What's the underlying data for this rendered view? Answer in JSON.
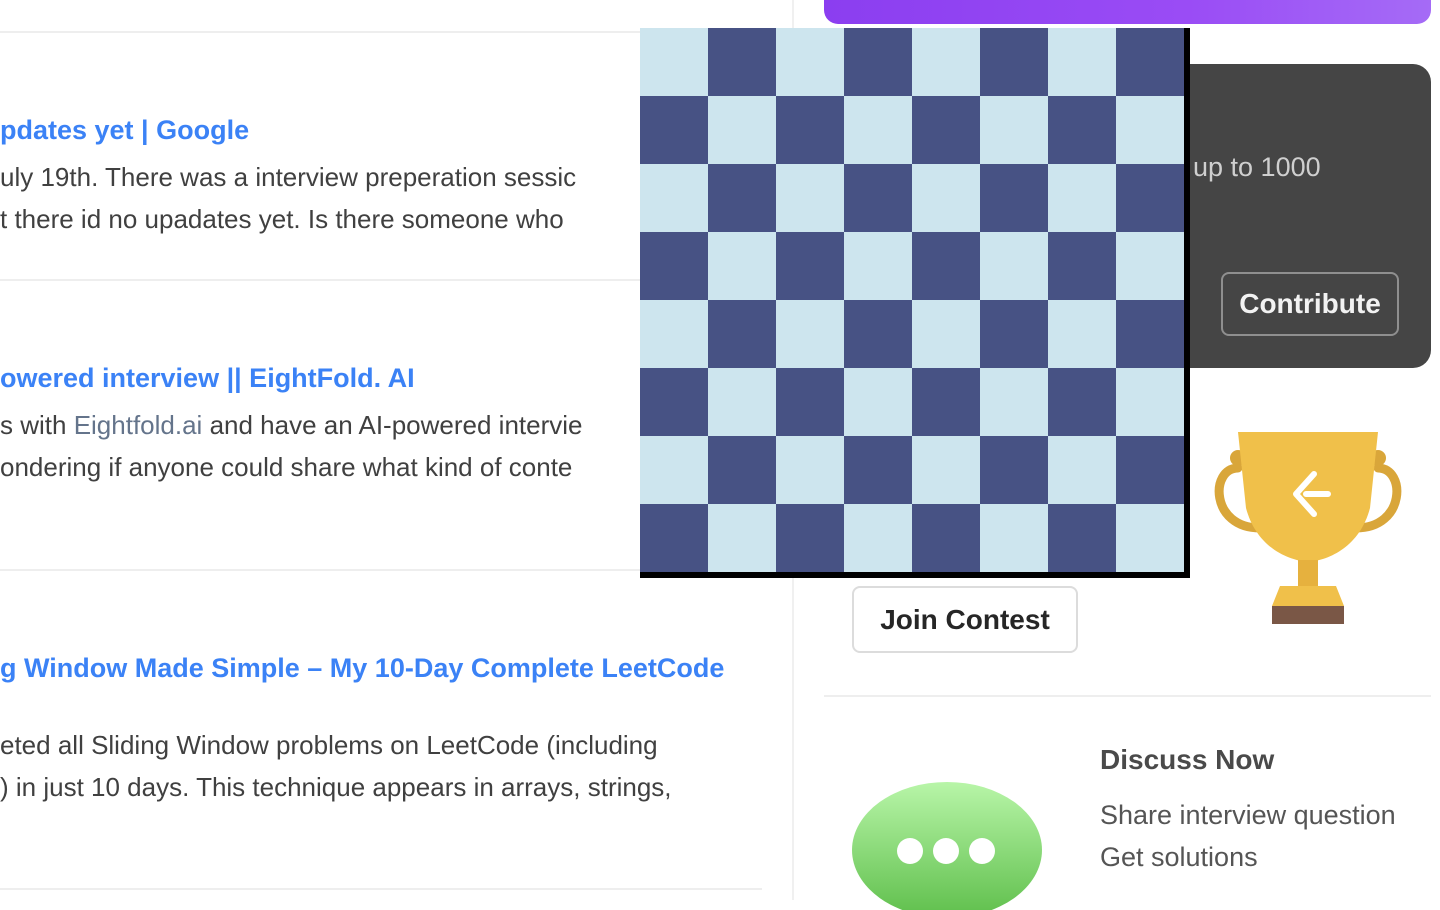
{
  "feed": {
    "posts": [
      {
        "title": "pdates yet | Google",
        "lines": [
          "uly 19th. There was a interview preperation sessic",
          "t there id no upadates yet. Is there someone who"
        ]
      },
      {
        "title": "owered interview || EightFold. AI",
        "line1_prefix": "s with ",
        "line1_link": "Eightfold.ai",
        "line1_suffix": " and have an AI-powered intervie",
        "line2": "ondering if anyone could share what kind of conte"
      },
      {
        "title": "g Window Made Simple – My 10-Day Complete LeetCode",
        "lines": [
          "eted all Sliding Window problems on LeetCode (including",
          ") in just 10 days. This technique appears in arrays, strings,"
        ]
      }
    ]
  },
  "sidebar": {
    "contribute_card": {
      "text": "up to 1000",
      "button_label": "Contribute"
    },
    "contest": {
      "button_label": "Join Contest"
    },
    "discuss": {
      "title": "Discuss Now",
      "line1": "Share interview question",
      "line2": "Get solutions"
    }
  },
  "colors": {
    "link": "#3b82f6",
    "chess_dark": "#475284",
    "chess_light": "#cde5ee",
    "trophy": "#f0c04a"
  }
}
